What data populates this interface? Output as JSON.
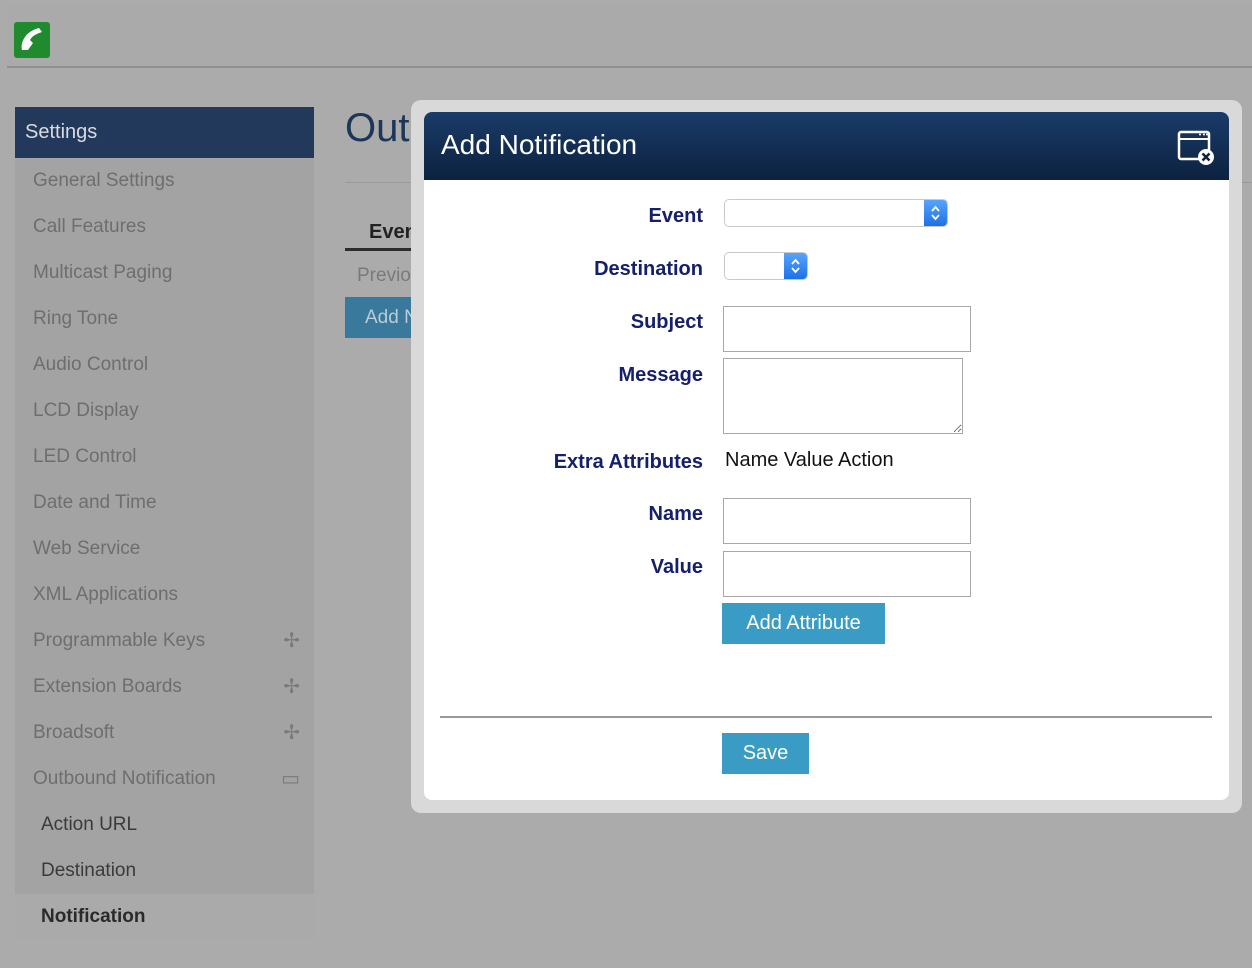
{
  "header": {
    "logo_icon": "phone-handset-icon"
  },
  "sidebar": {
    "title": "Settings",
    "items": [
      {
        "label": "General Settings",
        "expander": ""
      },
      {
        "label": "Call Features",
        "expander": ""
      },
      {
        "label": "Multicast Paging",
        "expander": ""
      },
      {
        "label": "Ring Tone",
        "expander": ""
      },
      {
        "label": "Audio Control",
        "expander": ""
      },
      {
        "label": "LCD Display",
        "expander": ""
      },
      {
        "label": "LED Control",
        "expander": ""
      },
      {
        "label": "Date and Time",
        "expander": ""
      },
      {
        "label": "Web Service",
        "expander": ""
      },
      {
        "label": "XML Applications",
        "expander": ""
      },
      {
        "label": "Programmable Keys",
        "expander": "plus"
      },
      {
        "label": "Extension Boards",
        "expander": "plus"
      },
      {
        "label": "Broadsoft",
        "expander": "plus"
      },
      {
        "label": "Outbound Notification",
        "expander": "minus"
      }
    ],
    "subitems": [
      {
        "label": "Action URL"
      },
      {
        "label": "Destination"
      },
      {
        "label": "Notification",
        "active": true
      }
    ]
  },
  "background": {
    "title": "Out",
    "tab": "Event",
    "previous": "Previo",
    "add": "Add N"
  },
  "modal": {
    "title": "Add Notification",
    "close_icon": "close-window-icon",
    "labels": {
      "event": "Event",
      "destination": "Destination",
      "subject": "Subject",
      "message": "Message",
      "extra_attributes": "Extra Attributes",
      "name": "Name",
      "value": "Value"
    },
    "values": {
      "event": "",
      "destination": "",
      "subject": "",
      "message": "",
      "name": "",
      "value": ""
    },
    "attributes_header": "Name Value Action",
    "add_attribute_label": "Add Attribute",
    "save_label": "Save"
  },
  "colors": {
    "modal_header": "#0c223f",
    "label_text": "#14206b",
    "button": "#3a9cc4",
    "sidebar_header": "#23395b"
  }
}
